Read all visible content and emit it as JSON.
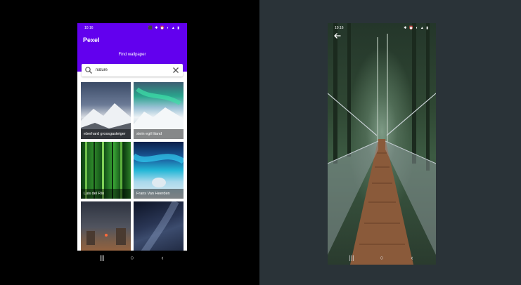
{
  "left_phone": {
    "status_time": "10:16",
    "status_icons": "⬛ ✱ ⏰ ◐ ▲ ▮",
    "app_title": "Pexel",
    "subtitle": "Find wallpaper",
    "search": {
      "value": "nature",
      "placeholder": ""
    },
    "photos": [
      {
        "caption": "eberhard grossgasteiger"
      },
      {
        "caption": "stein egil liland"
      },
      {
        "caption": "Luis del Río"
      },
      {
        "caption": "Frans Van Heerden"
      },
      {
        "caption": ""
      },
      {
        "caption": ""
      }
    ],
    "nav": {
      "recent": "|||",
      "home": "○",
      "back": "‹"
    }
  },
  "right_phone": {
    "status_time": "10:16",
    "status_icons": "✱ ⏰ ◐ ▲ ▮",
    "nav": {
      "recent": "|||",
      "home": "○",
      "back": "‹"
    }
  },
  "colors": {
    "app_bar": "#6200ee",
    "right_background": "#2a3338",
    "left_background": "#000000"
  }
}
